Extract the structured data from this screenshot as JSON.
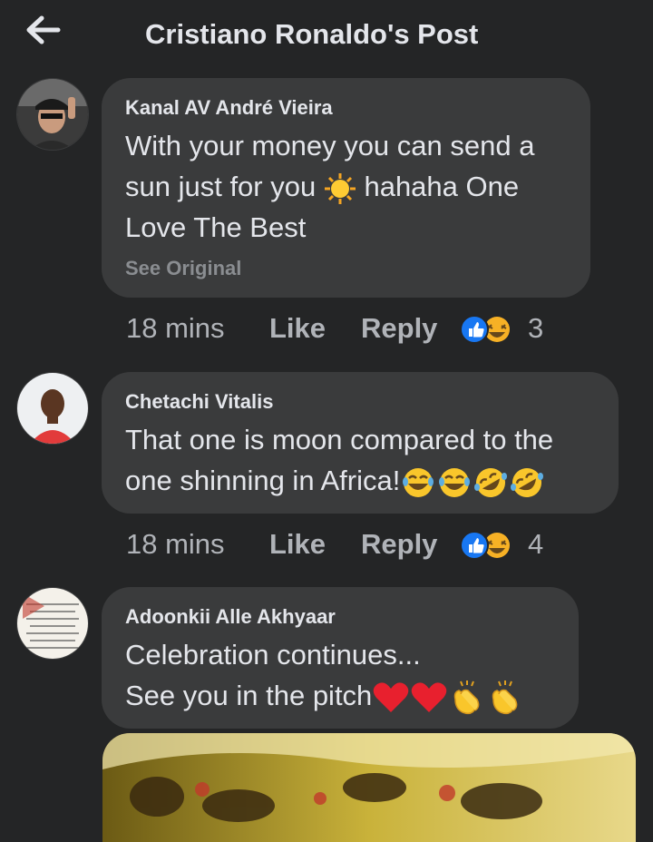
{
  "header": {
    "title": "Cristiano Ronaldo's Post",
    "back_icon": "arrow-left-icon"
  },
  "comments": [
    {
      "author": "Kanal AV André Vieira",
      "text_line1": "With your money you can send a",
      "text_line2a": "sun just for you ",
      "text_line2b": " hahaha One",
      "text_line3": "Love The Best",
      "see_original": "See Original",
      "time": "18 mins",
      "like": "Like",
      "reply": "Reply",
      "reaction_count": "3"
    },
    {
      "author": "Chetachi Vitalis",
      "text_line1": "That one is moon compared to the",
      "text_line2": "one shinning in Africa!",
      "time": "18 mins",
      "like": "Like",
      "reply": "Reply",
      "reaction_count": "4"
    },
    {
      "author": "Adoonkii Alle Akhyaar",
      "text_line1": "Celebration continues...",
      "text_line2": "See you in the pitch",
      "time": "",
      "like": "",
      "reply": "",
      "reaction_count": ""
    }
  ],
  "colors": {
    "background": "#242526",
    "bubble": "#3a3b3c",
    "like_blue": "#1877f2",
    "muted": "#b0b3b8"
  }
}
